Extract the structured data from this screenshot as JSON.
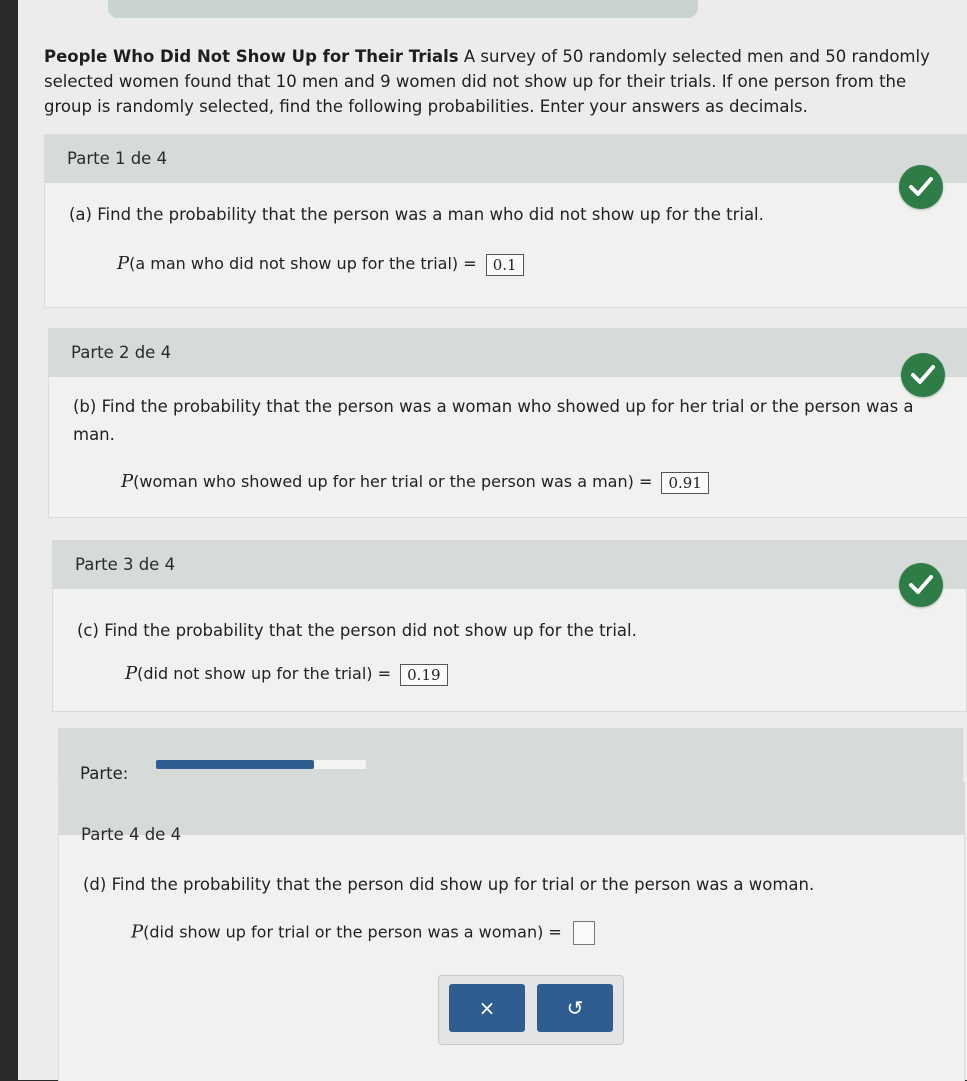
{
  "intro": {
    "title": "People Who Did Not Show Up for Their Trials",
    "text": "A survey of 50 randomly selected men and 50 randomly selected women found that 10 men and 9 women did not show up for their trials. If one person from the group is randomly selected, find the following probabilities. Enter your answers as decimals."
  },
  "parts": [
    {
      "header": "Parte 1 de 4",
      "question": "(a) Find the probability that the person was a man who did not show up for the trial.",
      "p": "P",
      "event": "(a man who did not show up for the trial)",
      "equals": "=",
      "answer": "0.1"
    },
    {
      "header": "Parte 2 de 4",
      "question": "(b) Find the probability that the person was a woman who showed up for her trial or the person was a man.",
      "p": "P",
      "event": "(woman who showed up for her trial or the person was a man)",
      "equals": "=",
      "answer": "0.91"
    },
    {
      "header": "Parte 3 de 4",
      "question": "(c) Find the probability that the person did not show up for the trial.",
      "p": "P",
      "event": "(did not show up for the trial)",
      "equals": "=",
      "answer": "0.19"
    },
    {
      "header": "Parte 4 de 4",
      "question": "(d) Find the probability that the person did show up for trial or the person was a woman.",
      "p": "P",
      "event": "(did show up for trial or the person was a woman)",
      "equals": "=",
      "answer": ""
    }
  ],
  "progress": {
    "label": "Parte:",
    "fraction": 0.75,
    "fill_color": "#2f5d8f"
  },
  "buttons": {
    "clear_label": "×",
    "undo_label": "↺"
  },
  "colors": {
    "check": "#2e7d46",
    "header": "#d6dbd9",
    "button": "#2f5d8f"
  }
}
